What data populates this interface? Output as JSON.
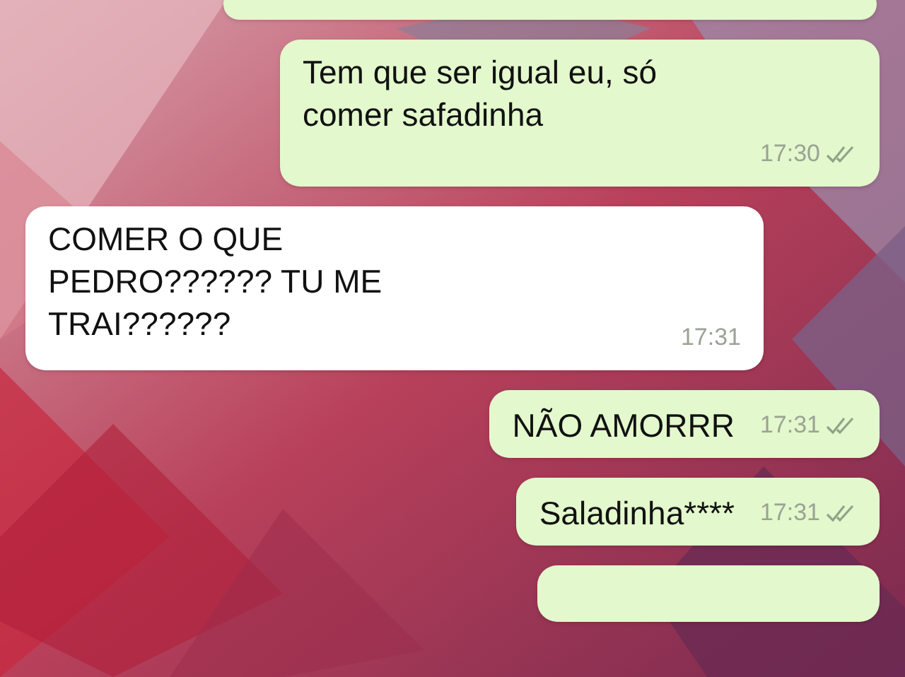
{
  "messages": [
    {
      "kind": "outgoing"
    },
    {
      "kind": "outgoing",
      "text": "Tem que ser igual eu, só\ncomer safadinha",
      "time": "17:30"
    },
    {
      "kind": "incoming",
      "text": "COMER O QUE\nPEDRO?????? TU ME\nTRAI??????",
      "time": "17:31"
    },
    {
      "kind": "outgoing",
      "text": "NÃO AMORRR",
      "time": "17:31"
    },
    {
      "kind": "outgoing",
      "text": "Saladinha****",
      "time": "17:31"
    },
    {
      "kind": "outgoing"
    }
  ]
}
